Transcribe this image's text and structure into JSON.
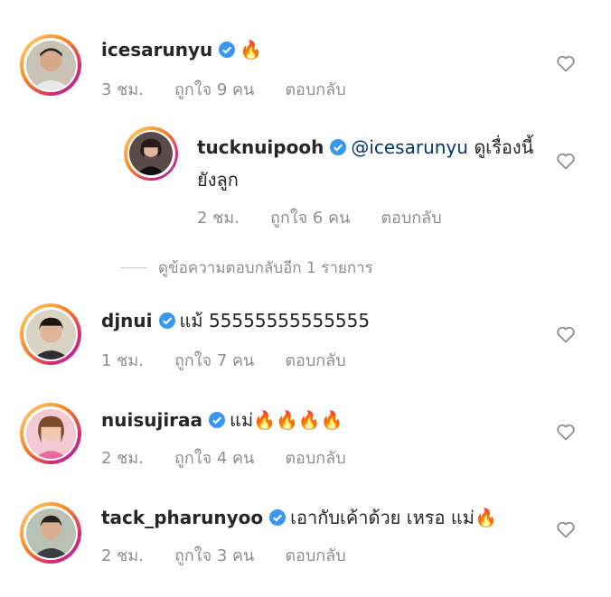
{
  "colors": {
    "verified": "#3897f0",
    "muted": "#8e8e8e",
    "text": "#262626",
    "mention": "#00376b"
  },
  "comments": [
    {
      "username": "icesarunyu",
      "text": "🔥",
      "time": "3 ชม.",
      "likes": "ถูกใจ 9 คน",
      "reply": "ตอบกลับ"
    },
    {
      "username": "tucknuipooh",
      "mention": "@icesarunyu",
      "text": "ดูเรื่องนี้",
      "text2": "ยังลูก",
      "time": "2 ชม.",
      "likes": "ถูกใจ 6 คน",
      "reply": "ตอบกลับ"
    },
    {
      "username": "djnui",
      "text": "แม้ 55555555555555",
      "time": "1 ชม.",
      "likes": "ถูกใจ 7 คน",
      "reply": "ตอบกลับ"
    },
    {
      "username": "nuisujiraa",
      "text": "แม่🔥🔥🔥🔥",
      "time": "2 ชม.",
      "likes": "ถูกใจ 4 คน",
      "reply": "ตอบกลับ"
    },
    {
      "username": "tack_pharunyoo",
      "text": "เอากับเค้าด้วย เหรอ แม่🔥",
      "time": "2 ชม.",
      "likes": "ถูกใจ 3 คน",
      "reply": "ตอบกลับ"
    }
  ],
  "view_replies": "ดูข้อความตอบกลับอีก 1 รายการ"
}
